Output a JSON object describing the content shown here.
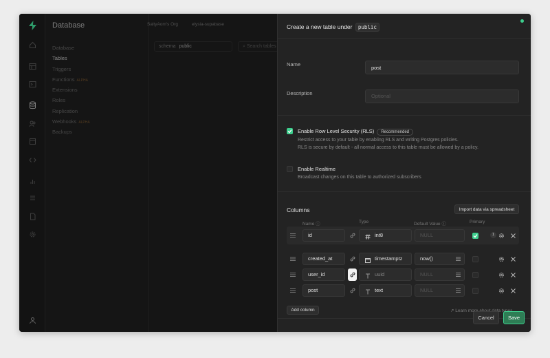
{
  "app": {
    "section_title": "Database",
    "breadcrumbs": [
      "SaltyAom's Org",
      "elysia-supabase"
    ],
    "icons": [
      "supabase-logo-icon",
      "home-icon",
      "table-editor-icon",
      "sql-editor-icon",
      "database-icon",
      "auth-icon",
      "storage-icon",
      "edge-functions-icon",
      "reports-icon",
      "logs-icon",
      "api-docs-icon",
      "settings-icon",
      "user-icon"
    ]
  },
  "nav": {
    "items": [
      {
        "label": "Database",
        "active": false
      },
      {
        "label": "Tables",
        "active": true
      },
      {
        "label": "Triggers",
        "active": false
      },
      {
        "label": "Functions",
        "active": false,
        "badge": "ALPHA"
      },
      {
        "label": "Extensions",
        "active": false
      },
      {
        "label": "Roles",
        "active": false
      },
      {
        "label": "Replication",
        "active": false
      },
      {
        "label": "Webhooks",
        "active": false,
        "badge": "ALPHA"
      },
      {
        "label": "Backups",
        "active": false
      }
    ]
  },
  "toolbar": {
    "schema_prefix": "schema",
    "schema_value": "public",
    "search_placeholder": "Search tables"
  },
  "panel": {
    "title_prefix": "Create a new table under",
    "title_schema": "public",
    "name_label": "Name",
    "name_value": "post",
    "description_label": "Description",
    "description_placeholder": "Optional",
    "rls": {
      "title": "Enable Row Level Security (RLS)",
      "badge": "Recommended",
      "desc1": "Restrict access to your table by enabling RLS and writing Postgres policies.",
      "desc2": "RLS is secure by default - all normal access to this table must be allowed by a policy.",
      "checked": true
    },
    "realtime": {
      "title": "Enable Realtime",
      "desc": "Broadcast changes on this table to authorized subscribers",
      "checked": false
    },
    "columns_title": "Columns",
    "import_label": "Import data via spreadsheet",
    "headers": {
      "name": "Name",
      "type": "Type",
      "default": "Default Value",
      "primary": "Primary"
    },
    "rows": [
      {
        "name": "id",
        "type": "int8",
        "type_icon": "hash-icon",
        "default": "NULL",
        "primary": true,
        "badge": "1"
      },
      {
        "name": "created_at",
        "type": "timestamptz",
        "type_icon": "calendar-icon",
        "default": "now()",
        "primary": false
      },
      {
        "name": "user_id",
        "type": "uuid",
        "type_icon": "text-type-icon",
        "default": "NULL",
        "primary": false
      },
      {
        "name": "post",
        "type": "text",
        "type_icon": "text-type-icon",
        "default": "NULL",
        "primary": false
      }
    ],
    "add_column_label": "Add column",
    "learn_more_label": "Learn more about data types",
    "cancel_label": "Cancel",
    "save_label": "Save"
  },
  "colors": {
    "accent": "#3ecf8e",
    "save_bg": "#2e7d55"
  }
}
